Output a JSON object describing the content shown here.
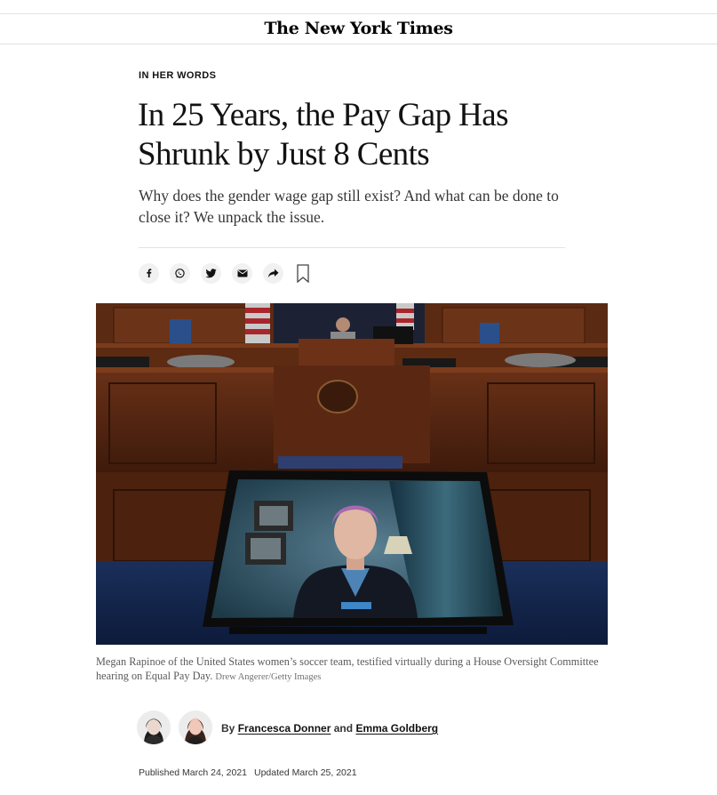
{
  "masthead": {
    "title": "The New York Times"
  },
  "article": {
    "kicker": "IN HER WORDS",
    "headline_line1": "In 25 Years, the Pay Gap Has",
    "headline_line2": "Shrunk by Just 8 Cents",
    "summary": "Why does the gender wage gap still exist? And what can be done to close it? We unpack the issue."
  },
  "share": {
    "icons": [
      "facebook-icon",
      "whatsapp-icon",
      "twitter-icon",
      "email-icon",
      "share-icon",
      "bookmark-icon"
    ]
  },
  "image": {
    "caption": "Megan Rapinoe of the United States women’s soccer team, testified virtually during a House Oversight Committee hearing on Equal Pay Day.",
    "credit": "Drew Angerer/Getty Images"
  },
  "byline": {
    "prefix": "By",
    "author1": "Francesca Donner",
    "conjunction": "and",
    "author2": "Emma Goldberg"
  },
  "dates": {
    "published": "Published March 24, 2021",
    "updated": "Updated March 25, 2021"
  },
  "colors": {
    "text": "#121212",
    "rule": "#e2e2e2",
    "caption": "#5a5a5a"
  }
}
